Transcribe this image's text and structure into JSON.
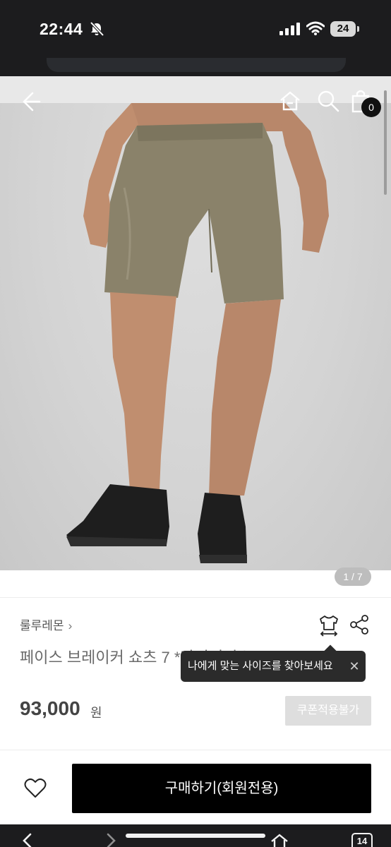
{
  "status_bar": {
    "time": "22:44",
    "battery": "24",
    "icons": [
      "bell-muted-icon",
      "cellular-signal-icon",
      "wifi-icon",
      "battery-icon"
    ]
  },
  "nav": {
    "icons": [
      "back-arrow-icon",
      "home-icon",
      "search-icon",
      "shopping-bag-icon"
    ],
    "cart_count": "0"
  },
  "gallery": {
    "counter": "1 / 7"
  },
  "product": {
    "brand": "룰루레몬",
    "brand_chevron": "›",
    "title": "페이스 브레이커 쇼츠 7 *라이너리스 - ROVE",
    "price": "93,000",
    "price_unit": "원",
    "coupon_label": "쿠폰적용불가",
    "action_icons": [
      "size-guide-shirt-icon",
      "share-icon"
    ]
  },
  "tooltip": {
    "text": "나에게 맞는 사이즈를 찾아보세요",
    "close": "✕"
  },
  "purchase_bar": {
    "buy_label": "구매하기(회원전용)",
    "wishlist_icon": "heart-icon"
  },
  "browser_toolbar": {
    "tab_count": "14",
    "icons": [
      "back-icon",
      "forward-icon",
      "home-icon",
      "tabs-icon"
    ]
  },
  "colors": {
    "accent": "#000000",
    "status_bar_bg": "#1c1c1e",
    "badge_bg": "#111111",
    "disabled_button": "#dedede"
  }
}
